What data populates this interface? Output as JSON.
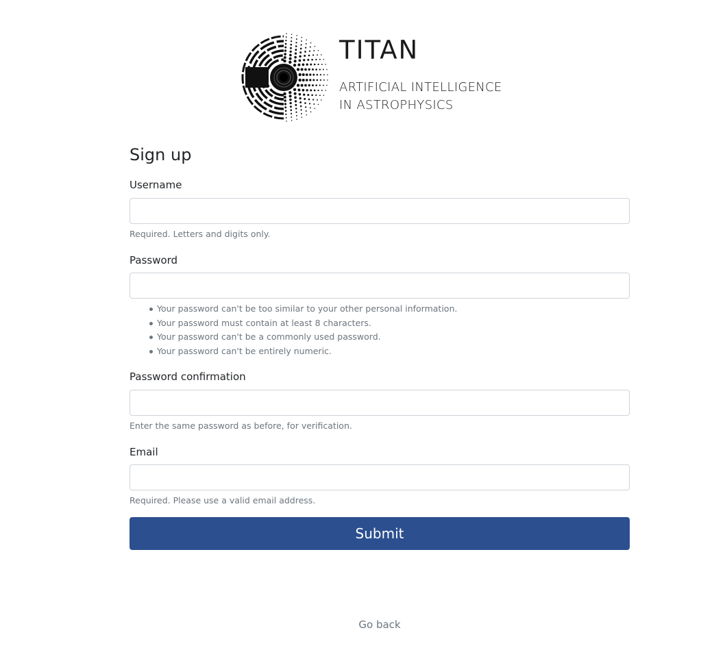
{
  "logo": {
    "title": "TITAN",
    "subtitle_line1": "ARTIFICIAL INTELLIGENCE",
    "subtitle_line2": "IN ASTROPHYSICS"
  },
  "form": {
    "heading": "Sign up",
    "username": {
      "label": "Username",
      "value": "",
      "help": "Required. Letters and digits only."
    },
    "password": {
      "label": "Password",
      "value": "",
      "rules": [
        "Your password can't be too similar to your other personal information.",
        "Your password must contain at least 8 characters.",
        "Your password can't be a commonly used password.",
        "Your password can't be entirely numeric."
      ]
    },
    "password_confirmation": {
      "label": "Password confirmation",
      "value": "",
      "help": "Enter the same password as before, for verification."
    },
    "email": {
      "label": "Email",
      "value": "",
      "help": "Required. Please use a valid email address."
    },
    "submit_label": "Submit"
  },
  "footer": {
    "go_back": "Go back"
  },
  "colors": {
    "primary": "#2c4f8f",
    "muted": "#6c757d",
    "border": "#ced4da"
  }
}
